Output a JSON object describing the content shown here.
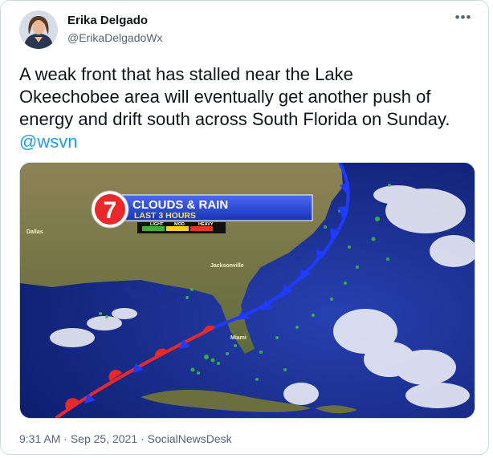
{
  "author": {
    "name": "Erika Delgado",
    "handle": "@ErikaDelgadoWx"
  },
  "more_icon": "more-horizontal-icon",
  "tweet": {
    "text_lines": [
      "A weak front that has stalled near the Lake",
      "Okeechobee area will eventually get another push of",
      "energy and drift south across South Florida on Sunday."
    ],
    "mention": "@wsvn"
  },
  "media": {
    "logo_number": "7",
    "title": "CLOUDS & RAIN",
    "subtitle": "LAST 3 HOURS",
    "legend": [
      "LIGHT",
      "MOD.",
      "HEAVY"
    ],
    "legend_colors": [
      "#3fae3f",
      "#f2d21b",
      "#e03a1e"
    ],
    "cities": [
      "Jacksonville",
      "Miami",
      "Dallas"
    ],
    "cold_front_color": "#1f3bff",
    "warm_front_color": "#e8282b"
  },
  "meta": {
    "time": "9:31 AM",
    "separator": "·",
    "date": "Sep 25, 2021",
    "source": "SocialNewsDesk"
  }
}
